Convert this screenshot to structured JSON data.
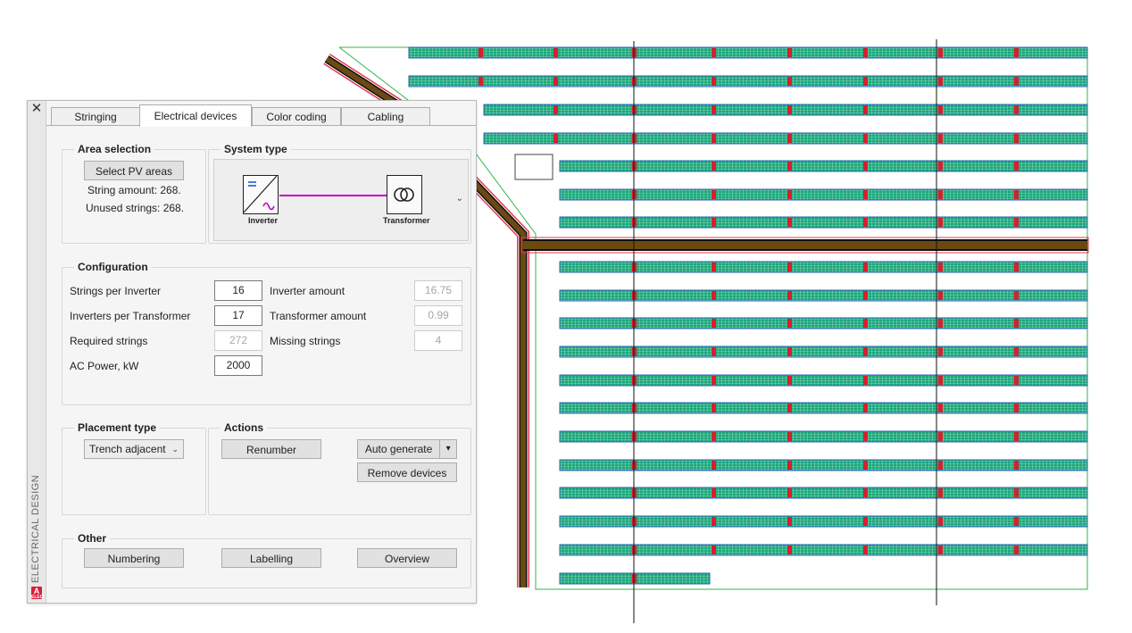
{
  "palette": {
    "side_title": "ELECTRICAL DESIGN",
    "close_glyph": "✕",
    "logo_letter": "A",
    "logo_sub": "ELEC",
    "tabs": [
      {
        "label": "Stringing",
        "active": false
      },
      {
        "label": "Electrical devices",
        "active": true
      },
      {
        "label": "Color coding",
        "active": false
      },
      {
        "label": "Cabling",
        "active": false
      }
    ],
    "area_selection": {
      "title": "Area selection",
      "select_button": "Select PV areas",
      "string_amount": "String amount: 268.",
      "unused_strings": "Unused strings: 268."
    },
    "system_type": {
      "title": "System type",
      "inverter_label": "Inverter",
      "transformer_label": "Transformer",
      "dropdown_glyph": "⌄"
    },
    "configuration": {
      "title": "Configuration",
      "strings_per_inverter_label": "Strings per Inverter",
      "strings_per_inverter": "16",
      "inverters_per_transformer_label": "Inverters per Transformer",
      "inverters_per_transformer": "17",
      "required_strings_label": "Required strings",
      "required_strings": "272",
      "ac_power_label": "AC Power, kW",
      "ac_power": "2000",
      "inverter_amount_label": "Inverter amount",
      "inverter_amount": "16.75",
      "transformer_amount_label": "Transformer amount",
      "transformer_amount": "0.99",
      "missing_strings_label": "Missing strings",
      "missing_strings": "4"
    },
    "placement": {
      "title": "Placement type",
      "value": "Trench adjacent",
      "chevron": "⌄"
    },
    "actions": {
      "title": "Actions",
      "renumber": "Renumber",
      "auto_generate": "Auto generate",
      "split_glyph": "▾",
      "remove_devices": "Remove devices"
    },
    "other": {
      "title": "Other",
      "numbering": "Numbering",
      "labelling": "Labelling",
      "overview": "Overview"
    }
  },
  "colors": {
    "pv_fill": "#1aa77a",
    "pv_border": "#2a63b8",
    "trench": "#6b4a12",
    "trench_edge": "#e23a4e",
    "boundary": "#35b34a",
    "device": "#d81f2b",
    "connector": "#c400c4"
  }
}
